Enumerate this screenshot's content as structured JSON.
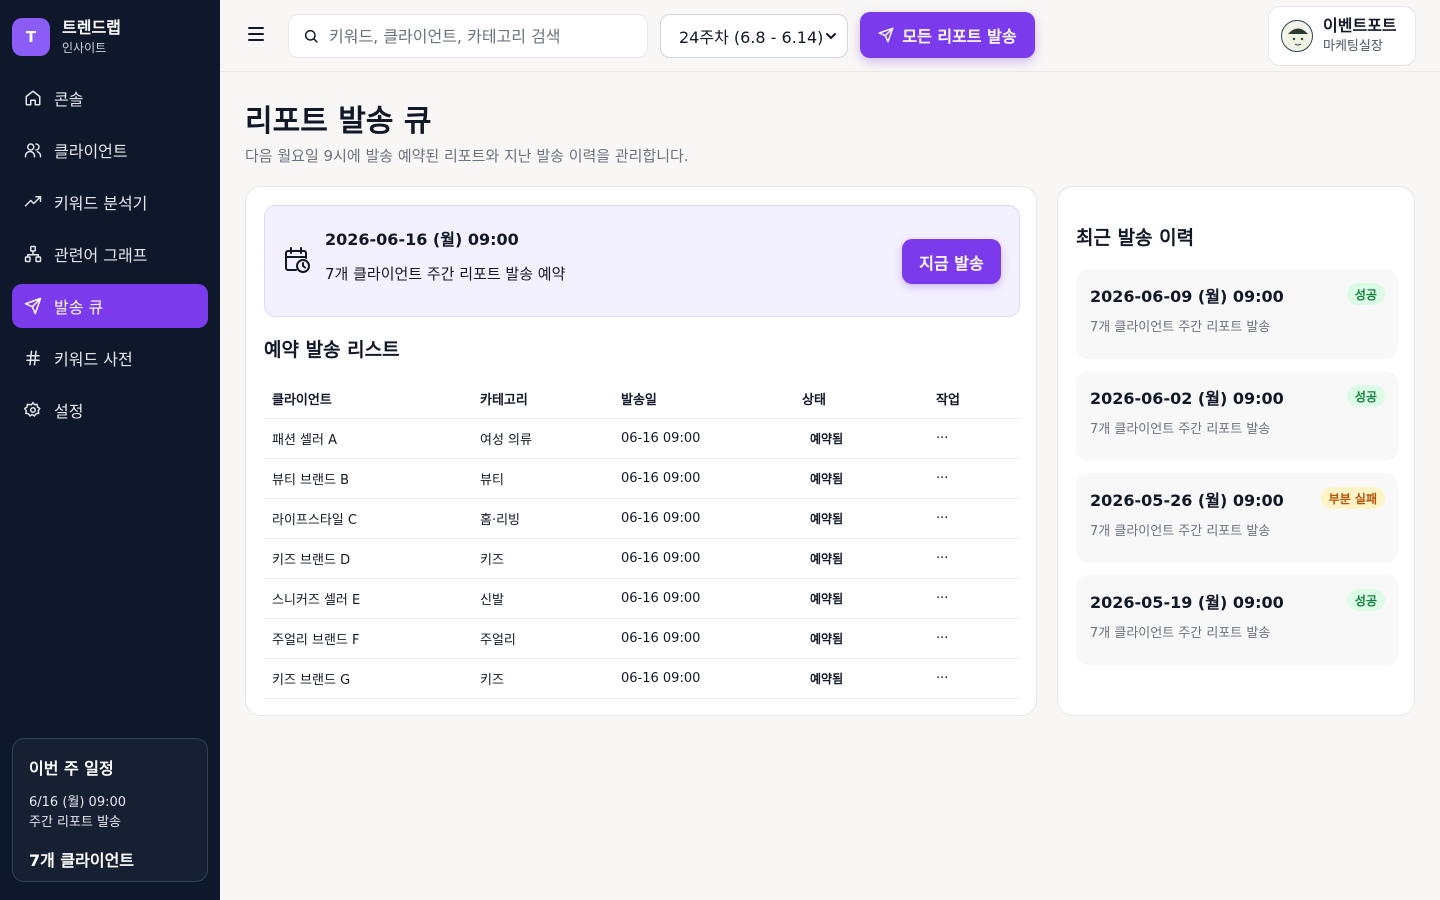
{
  "brand": {
    "logo_letter": "T",
    "name": "트렌드랩",
    "sub": "인사이트"
  },
  "nav": [
    {
      "label": "콘솔",
      "icon": "home-icon"
    },
    {
      "label": "클라이언트",
      "icon": "users-icon"
    },
    {
      "label": "키워드 분석기",
      "icon": "trending-up-icon"
    },
    {
      "label": "관련어 그래프",
      "icon": "network-icon"
    },
    {
      "label": "발송 큐",
      "icon": "send-icon",
      "active": true
    },
    {
      "label": "키워드 사전",
      "icon": "hash-icon"
    },
    {
      "label": "설정",
      "icon": "gear-icon"
    }
  ],
  "schedule": {
    "title": "이번 주 일정",
    "time": "6/16 (월) 09:00",
    "desc": "주간 리포트 발송",
    "count": "7개 클라이언트"
  },
  "header": {
    "search_placeholder": "키워드, 클라이언트, 카테고리 검색",
    "week": "24주차 (6.8 - 6.14)",
    "send_all": "모든 리포트 발송",
    "user_name": "이벤트포트",
    "user_role": "마케팅실장"
  },
  "page": {
    "title": "리포트 발송 큐",
    "desc": "다음 월요일 9시에 발송 예약된 리포트와 지난 발송 이력을 관리합니다."
  },
  "banner": {
    "date": "2026-06-16 (월) 09:00",
    "desc": "7개 클라이언트 주간 리포트 발송 예약",
    "button": "지금 발송"
  },
  "queue": {
    "title": "예약 발송 리스트",
    "columns": [
      "클라이언트",
      "카테고리",
      "발송일",
      "상태",
      "작업"
    ],
    "rows": [
      {
        "client": "패션 셀러 A",
        "category": "여성 의류",
        "date": "06-16 09:00",
        "status": "예약됨",
        "action": "···"
      },
      {
        "client": "뷰티 브랜드 B",
        "category": "뷰티",
        "date": "06-16 09:00",
        "status": "예약됨",
        "action": "···"
      },
      {
        "client": "라이프스타일 C",
        "category": "홈·리빙",
        "date": "06-16 09:00",
        "status": "예약됨",
        "action": "···"
      },
      {
        "client": "키즈 브랜드 D",
        "category": "키즈",
        "date": "06-16 09:00",
        "status": "예약됨",
        "action": "···"
      },
      {
        "client": "스니커즈 셀러 E",
        "category": "신발",
        "date": "06-16 09:00",
        "status": "예약됨",
        "action": "···"
      },
      {
        "client": "주얼리 브랜드 F",
        "category": "주얼리",
        "date": "06-16 09:00",
        "status": "예약됨",
        "action": "···"
      },
      {
        "client": "키즈 브랜드 G",
        "category": "키즈",
        "date": "06-16 09:00",
        "status": "예약됨",
        "action": "···"
      }
    ]
  },
  "history": {
    "title": "최근 발송 이력",
    "items": [
      {
        "date": "2026-06-09 (월) 09:00",
        "desc": "7개 클라이언트 주간 리포트 발송",
        "badge": "성공",
        "type": "ok"
      },
      {
        "date": "2026-06-02 (월) 09:00",
        "desc": "7개 클라이언트 주간 리포트 발송",
        "badge": "성공",
        "type": "ok"
      },
      {
        "date": "2026-05-26 (월) 09:00",
        "desc": "7개 클라이언트 주간 리포트 발송",
        "badge": "부분 실패",
        "type": "warn"
      },
      {
        "date": "2026-05-19 (월) 09:00",
        "desc": "7개 클라이언트 주간 리포트 발송",
        "badge": "성공",
        "type": "ok"
      }
    ]
  },
  "colors": {
    "accent": "#7c3aed",
    "sidebar_bg": "#0f172a",
    "success": "#15803d",
    "warning": "#b45309"
  }
}
